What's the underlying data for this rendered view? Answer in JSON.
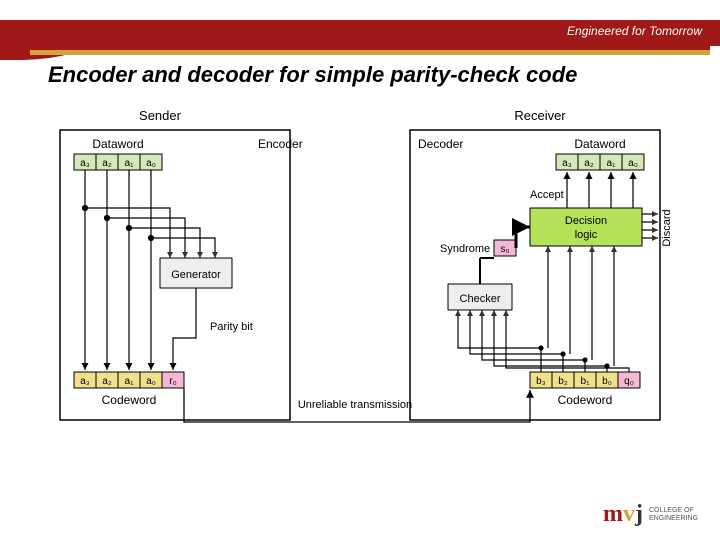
{
  "banner": {
    "tagline": "Engineered for Tomorrow"
  },
  "title": "Encoder and decoder for simple parity-check code",
  "diagram": {
    "sender_label": "Sender",
    "receiver_label": "Receiver",
    "encoder_label": "Encoder",
    "decoder_label": "Decoder",
    "dataword_label": "Dataword",
    "codeword_label": "Codeword",
    "generator_label": "Generator",
    "checker_label": "Checker",
    "parity_bit_label": "Parity bit",
    "accept_label": "Accept",
    "discard_label": "Discard",
    "syndrome_label": "Syndrome",
    "decision_logic_label": "Decision logic",
    "transmission_label": "Unreliable transmission",
    "dataword_bits": [
      "a₃",
      "a₂",
      "a₁",
      "a₀"
    ],
    "codeword_bits_sender": [
      "a₃",
      "a₂",
      "a₁",
      "a₀",
      "r₀"
    ],
    "codeword_bits_receiver": [
      "b₃",
      "b₂",
      "b₁",
      "b₀",
      "q₀"
    ],
    "syndrome_bit": "s₀"
  },
  "logo": {
    "m": "m",
    "v": "v",
    "j": "j",
    "line1": "COLLEGE OF",
    "line2": "ENGINEERING"
  }
}
